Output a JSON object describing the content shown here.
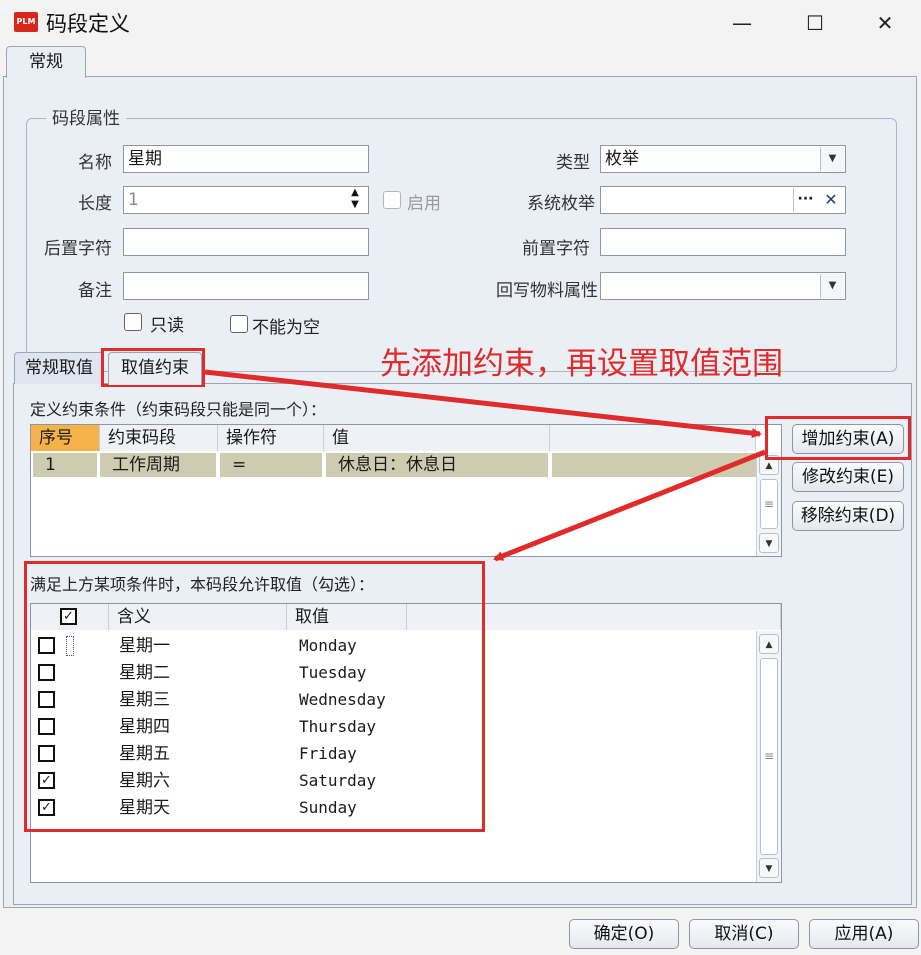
{
  "window": {
    "title": "码段定义",
    "app_icon": "PLM",
    "minimize": "—",
    "maximize": "☐",
    "close": "✕"
  },
  "top_tab": "常规",
  "group": {
    "legend": "码段属性",
    "name_label": "名称",
    "name_value": "星期",
    "length_label": "长度",
    "length_value": "1",
    "enable_label": "启用",
    "suffix_label": "后置字符",
    "suffix_value": "",
    "remark_label": "备注",
    "remark_value": "",
    "type_label": "类型",
    "type_value": "枚举",
    "sysenum_label": "系统枚举",
    "sysenum_value": "",
    "sysenum_browse": "···",
    "sysenum_clear": "✕",
    "prefix_label": "前置字符",
    "prefix_value": "",
    "writeback_label": "回写物料属性",
    "writeback_value": "",
    "readonly_label": "只读",
    "notnull_label": "不能为空"
  },
  "sub_tabs": [
    "常规取值",
    "取值约束"
  ],
  "annotation": "先添加约束，再设置取值范围",
  "constraint": {
    "caption": "定义约束条件（约束码段只能是同一个）：",
    "headers": [
      "序号",
      "约束码段",
      "操作符",
      "值"
    ],
    "rows": [
      {
        "index": "1",
        "segment": "工作周期",
        "op": "=",
        "value": "休息日：休息日"
      }
    ],
    "buttons": {
      "add": "增加约束(A)",
      "edit": "修改约束(E)",
      "remove": "移除约束(D)"
    }
  },
  "allowed": {
    "caption": "满足上方某项条件时，本码段允许取值（勾选）：",
    "headers": [
      "含义",
      "取值"
    ],
    "header_check": true,
    "rows": [
      {
        "meaning": "星期一",
        "value": "Monday",
        "checked": false
      },
      {
        "meaning": "星期二",
        "value": "Tuesday",
        "checked": false
      },
      {
        "meaning": "星期三",
        "value": "Wednesday",
        "checked": false
      },
      {
        "meaning": "星期四",
        "value": "Thursday",
        "checked": false
      },
      {
        "meaning": "星期五",
        "value": "Friday",
        "checked": false
      },
      {
        "meaning": "星期六",
        "value": "Saturday",
        "checked": true
      },
      {
        "meaning": "星期天",
        "value": "Sunday",
        "checked": true
      }
    ]
  },
  "footer": {
    "ok": "确定(O)",
    "cancel": "取消(C)",
    "apply": "应用(A)"
  },
  "colors": {
    "accent_red": "#e12a2a",
    "header_orange": "#f5b24a",
    "row_olive": "#cfcbb0"
  }
}
